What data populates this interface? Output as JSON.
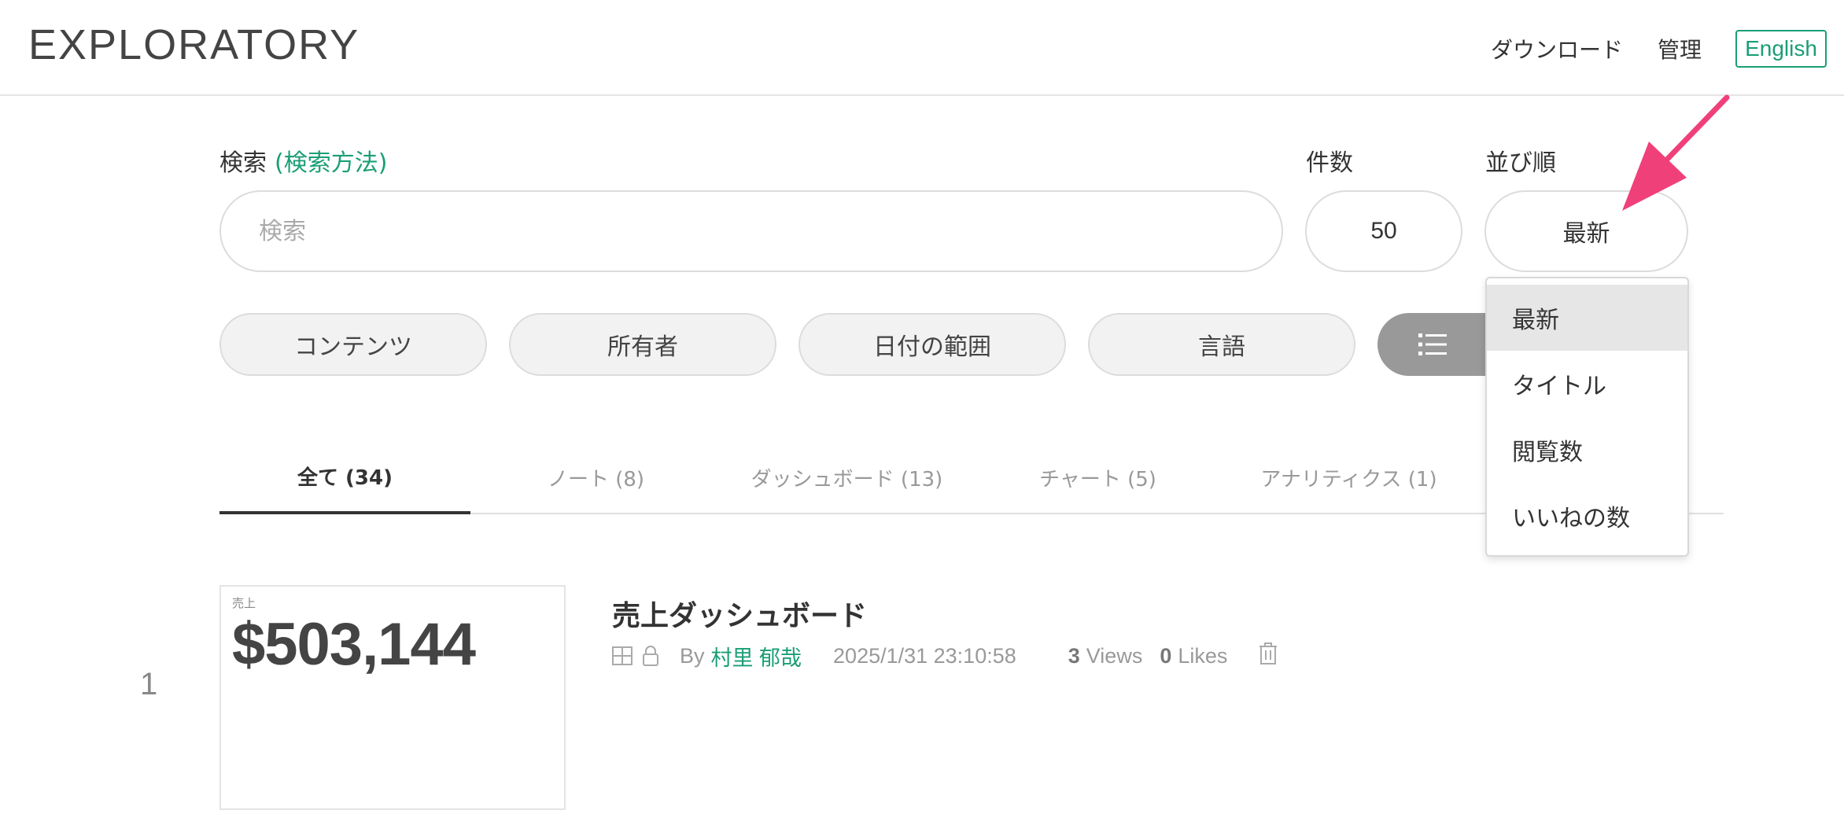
{
  "header": {
    "logo": "EXPLORATORY",
    "nav": {
      "download": "ダウンロード",
      "admin": "管理"
    },
    "language_button": "English"
  },
  "search": {
    "label": "検索",
    "help_link": "(検索方法)",
    "placeholder": "検索",
    "count_label": "件数",
    "count_value": "50",
    "sort_label": "並び順",
    "sort_value": "最新"
  },
  "filters": [
    "コンテンツ",
    "所有者",
    "日付の範囲",
    "言語"
  ],
  "tabs": [
    "全て (34)",
    "ノート (8)",
    "ダッシュボード (13)",
    "チャート (5)",
    "アナリティクス (1)"
  ],
  "active_tab": "全て (34)",
  "items": [
    {
      "index": "1",
      "thumb_label": "売上",
      "thumb_value": "$503,144",
      "title": "売上ダッシュボード",
      "by": "By",
      "owner": "村里 郁哉",
      "date": "2025/1/31 23:10:58",
      "views": "3",
      "views_label": "Views",
      "likes": "0",
      "likes_label": "Likes"
    }
  ],
  "sort_dropdown": {
    "options": [
      "最新",
      "タイトル",
      "閲覧数",
      "いいねの数"
    ],
    "selected": "最新"
  },
  "colors": {
    "accent": "#1a9e75",
    "arrow": "#f0407a"
  }
}
